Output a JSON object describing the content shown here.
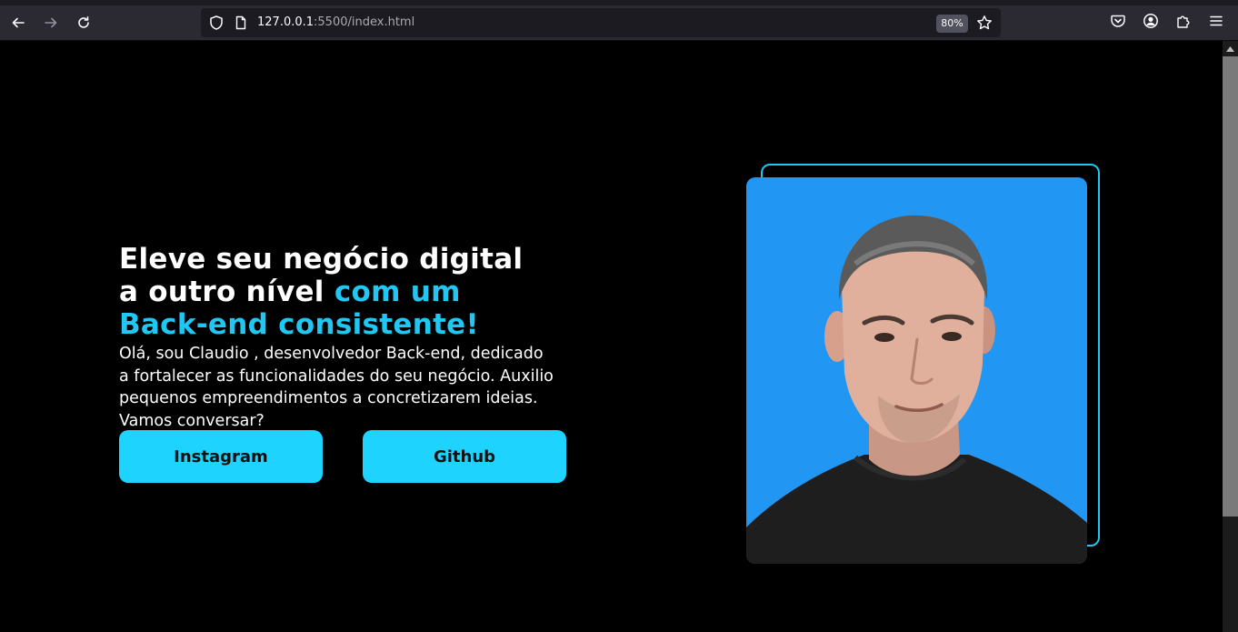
{
  "browser": {
    "url_host": "127.0.0.1",
    "url_path": ":5500/index.html",
    "zoom_level": "80%",
    "icons": [
      "back-arrow-icon",
      "forward-arrow-icon",
      "reload-icon",
      "shield-icon",
      "page-icon",
      "star-icon",
      "pocket-icon",
      "account-icon",
      "extensions-icon",
      "menu-icon"
    ]
  },
  "hero": {
    "title_line1": "Eleve seu negócio digital",
    "title_line2_white": "a outro nível ",
    "title_line2_accent": "com um",
    "title_line3_accent": "Back-end consistente!",
    "description": "Olá, sou Claudio , desenvolvedor Back-end, dedicado a fortalecer as funcionalidades do seu negócio. Auxilio pequenos empreendimentos a concretizarem ideias. Vamos conversar?",
    "buttons": {
      "instagram_label": "Instagram",
      "github_label": "Github"
    }
  },
  "colors": {
    "accent": "#1fc7f2",
    "button_bg": "#1fd3ff",
    "photo_bg": "#2196f3",
    "page_bg": "#000000"
  }
}
